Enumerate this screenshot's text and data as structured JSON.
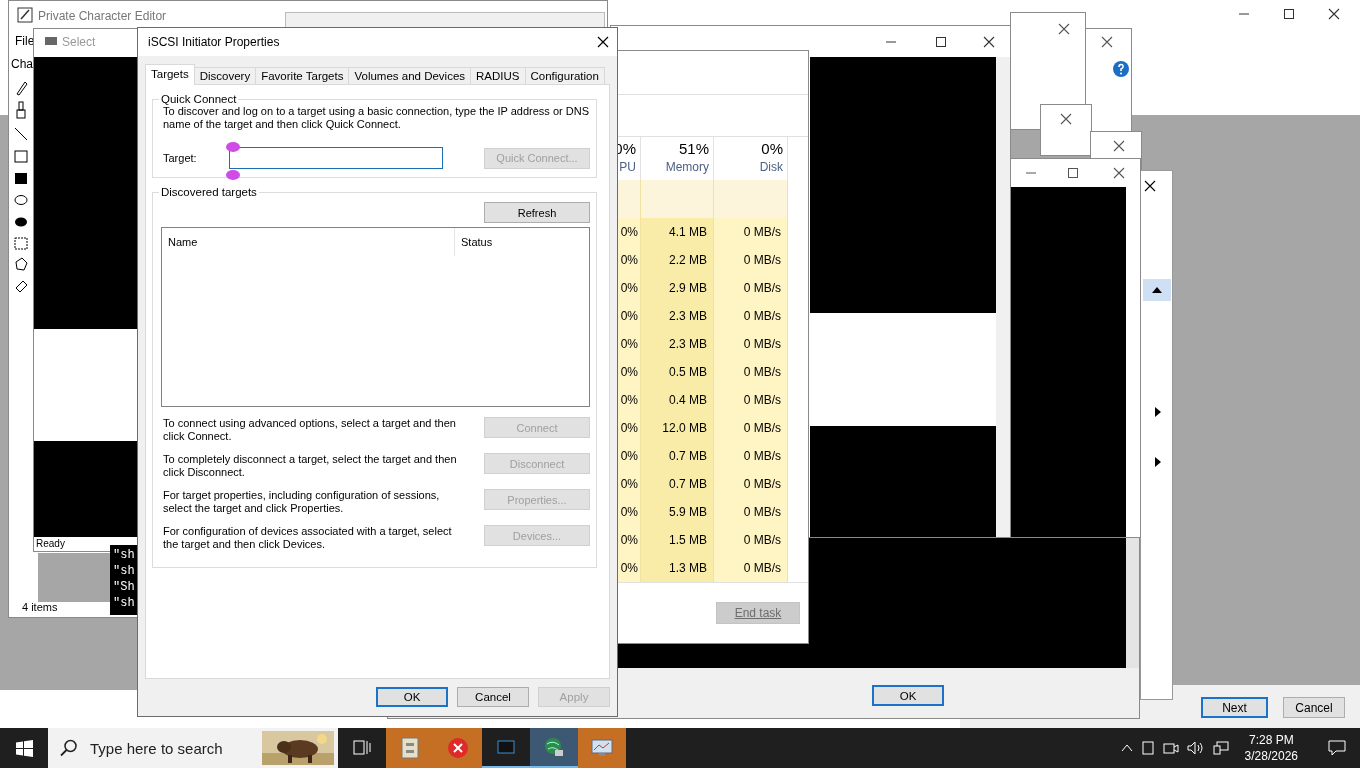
{
  "char_editor": {
    "title": "Private Character Editor",
    "menu": "File",
    "tab": "Cha",
    "status": "4 items"
  },
  "select_window": {
    "title": "Select",
    "status": "Ready"
  },
  "console": {
    "lines": [
      "\"sh",
      "\"sh",
      "\"Sh",
      "\"sh"
    ]
  },
  "iscsi": {
    "title": "iSCSI Initiator Properties",
    "tabs": [
      {
        "label": "Targets",
        "selected": true
      },
      {
        "label": "Discovery",
        "selected": false
      },
      {
        "label": "Favorite Targets",
        "selected": false
      },
      {
        "label": "Volumes and Devices",
        "selected": false
      },
      {
        "label": "RADIUS",
        "selected": false
      },
      {
        "label": "Configuration",
        "selected": false
      }
    ],
    "quick_connect": {
      "legend": "Quick Connect",
      "description": "To discover and log on to a target using a basic connection, type the IP address or DNS name of the target and then click Quick Connect.",
      "target_label": "Target:",
      "button": {
        "label": "Quick Connect...",
        "disabled": true
      }
    },
    "discovered": {
      "legend": "Discovered targets",
      "refresh": {
        "label": "Refresh",
        "disabled": false
      },
      "columns": [
        "Name",
        "Status"
      ],
      "actions": [
        {
          "text": "To connect using advanced options, select a target and then click Connect.",
          "button": {
            "label": "Connect",
            "disabled": true
          }
        },
        {
          "text": "To completely disconnect a target, select the target and then click Disconnect.",
          "button": {
            "label": "Disconnect",
            "disabled": true
          }
        },
        {
          "text": "For target properties, including configuration of sessions, select the target and click Properties.",
          "button": {
            "label": "Properties...",
            "disabled": true
          }
        },
        {
          "text": "For configuration of devices associated with a target, select the target and then click Devices.",
          "button": {
            "label": "Devices...",
            "disabled": true
          }
        }
      ]
    },
    "footer": [
      {
        "label": "OK",
        "disabled": false,
        "kind": "default"
      },
      {
        "label": "Cancel",
        "disabled": false,
        "kind": "normal"
      },
      {
        "label": "Apply",
        "disabled": true,
        "kind": "normal"
      }
    ]
  },
  "task_manager": {
    "columns": [
      {
        "value": "0%",
        "label": "PU"
      },
      {
        "value": "51%",
        "label": "Memory"
      },
      {
        "value": "0%",
        "label": "Disk"
      }
    ],
    "rows": [
      {
        "cpu": "0%",
        "memory": "4.1 MB",
        "disk": "0 MB/s"
      },
      {
        "cpu": "0%",
        "memory": "2.2 MB",
        "disk": "0 MB/s"
      },
      {
        "cpu": "0%",
        "memory": "2.9 MB",
        "disk": "0 MB/s"
      },
      {
        "cpu": "0%",
        "memory": "2.3 MB",
        "disk": "0 MB/s"
      },
      {
        "cpu": "0%",
        "memory": "2.3 MB",
        "disk": "0 MB/s"
      },
      {
        "cpu": "0%",
        "memory": "0.5 MB",
        "disk": "0 MB/s"
      },
      {
        "cpu": "0%",
        "memory": "0.4 MB",
        "disk": "0 MB/s"
      },
      {
        "cpu": "0%",
        "memory": "12.0 MB",
        "disk": "0 MB/s"
      },
      {
        "cpu": "0%",
        "memory": "0.7 MB",
        "disk": "0 MB/s"
      },
      {
        "cpu": "0%",
        "memory": "0.7 MB",
        "disk": "0 MB/s"
      },
      {
        "cpu": "0%",
        "memory": "5.9 MB",
        "disk": "0 MB/s"
      },
      {
        "cpu": "0%",
        "memory": "1.5 MB",
        "disk": "0 MB/s"
      },
      {
        "cpu": "0%",
        "memory": "1.3 MB",
        "disk": "0 MB/s"
      }
    ],
    "end_task": {
      "label": "End task",
      "disabled": true
    }
  },
  "message_box": {
    "ok": "OK"
  },
  "wizard": {
    "next": "Next",
    "cancel": "Cancel"
  },
  "taskbar": {
    "search_placeholder": "Type here to search",
    "time": "7:28 PM",
    "date": "3/28/2026"
  }
}
